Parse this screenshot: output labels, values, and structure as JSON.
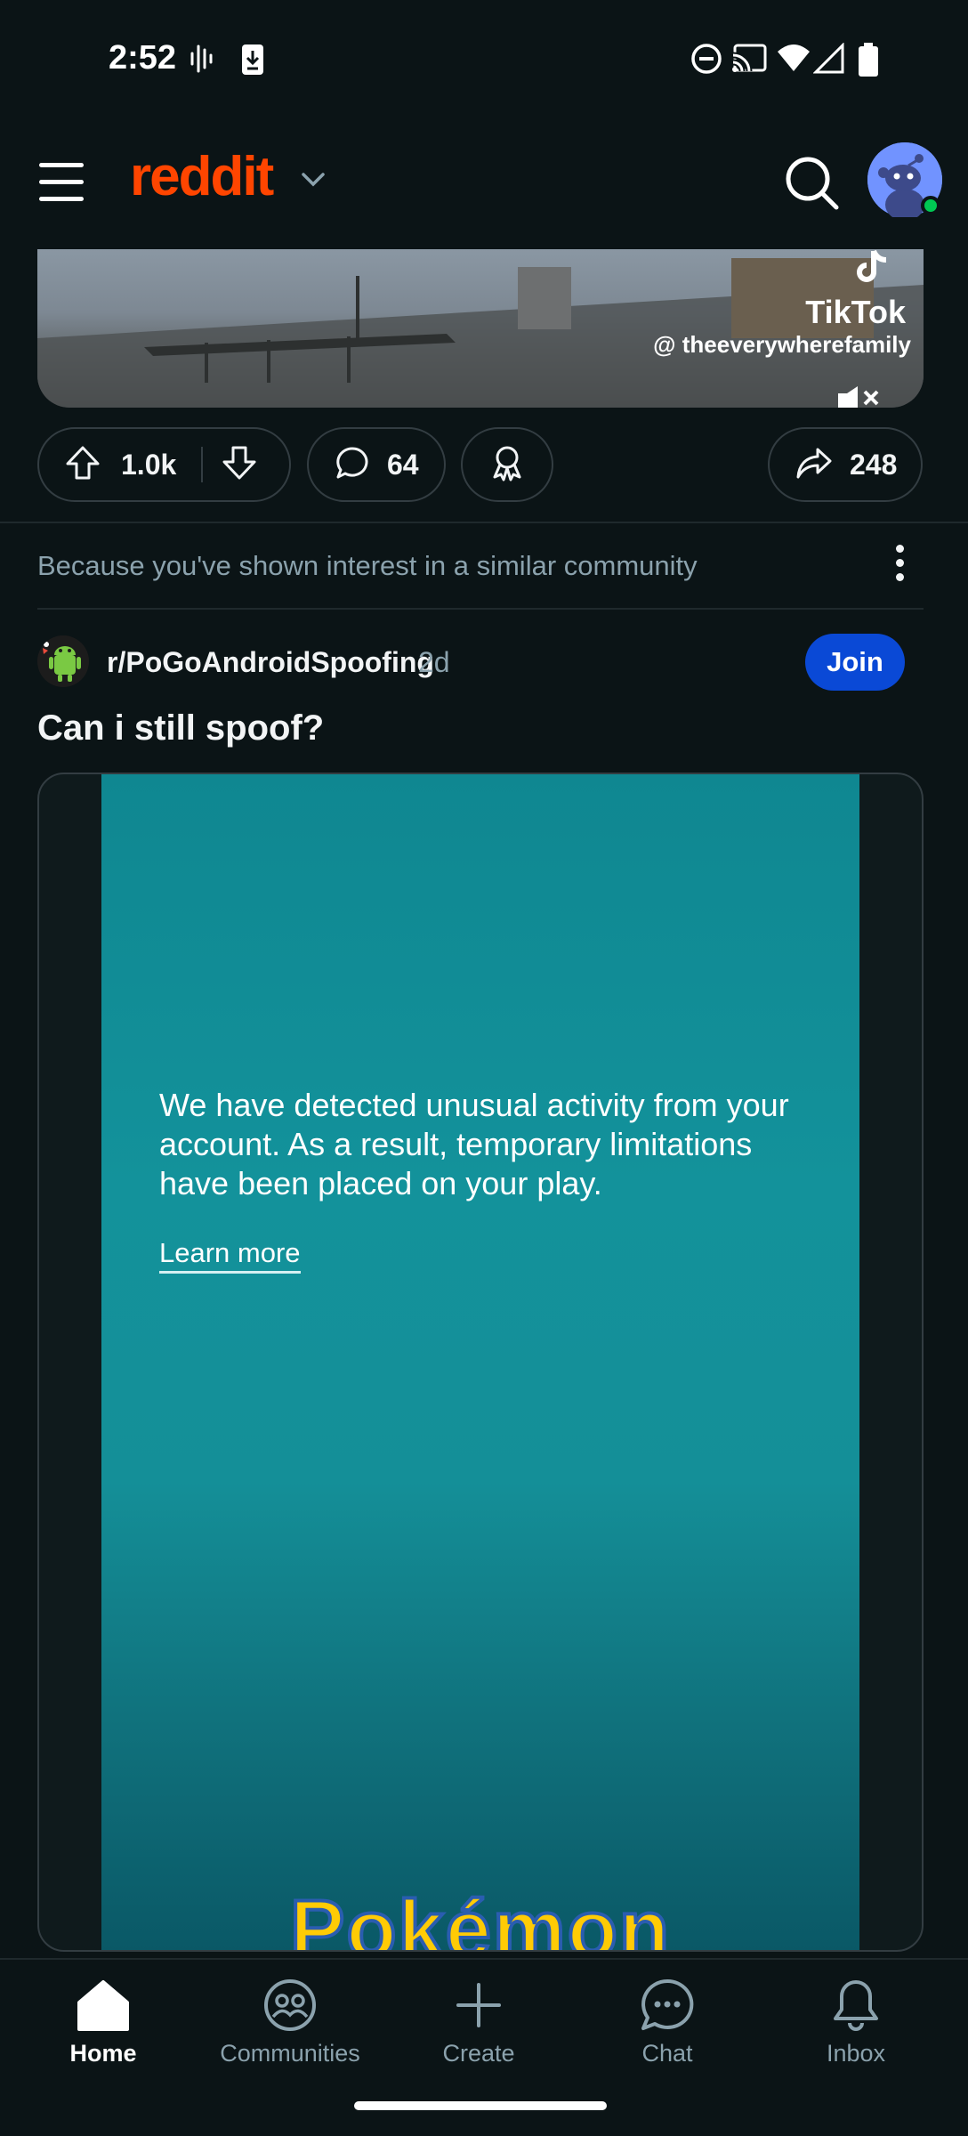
{
  "status_bar": {
    "time": "2:52",
    "left_icons": [
      "voicemail-wave-icon",
      "download-icon"
    ],
    "right_icons": [
      "do-not-disturb-icon",
      "cast-icon",
      "wifi-icon",
      "signal-icon",
      "battery-icon"
    ]
  },
  "header": {
    "logo": "reddit",
    "menu_icon": "hamburger-menu-icon",
    "search_icon": "search-icon",
    "avatar_icon": "snoo-avatar-icon",
    "brand_color": "#ff4500"
  },
  "prev_post": {
    "watermark_brand": "TikTok",
    "watermark_handle": "@ theeverywherefamily",
    "upvotes": "1.0k",
    "comments": "64",
    "shares": "248"
  },
  "recommendation": {
    "text": "Because you've shown interest in a similar community"
  },
  "post": {
    "subreddit": "r/PoGoAndroidSpoofing",
    "age": "2d",
    "join_label": "Join",
    "title": "Can i still spoof?",
    "media_message": "We have detected unusual activity from your account. As a result, temporary limitations have been placed on your play.",
    "media_link": "Learn more",
    "media_logo": "Pokémon"
  },
  "bottom_nav": {
    "items": [
      {
        "label": "Home",
        "icon": "home-icon"
      },
      {
        "label": "Communities",
        "icon": "communities-icon"
      },
      {
        "label": "Create",
        "icon": "plus-icon"
      },
      {
        "label": "Chat",
        "icon": "chat-icon"
      },
      {
        "label": "Inbox",
        "icon": "bell-icon"
      }
    ]
  },
  "colors": {
    "background": "#0b1416",
    "join_button": "#0a49d6",
    "secondary_text": "#8ba2ad"
  }
}
